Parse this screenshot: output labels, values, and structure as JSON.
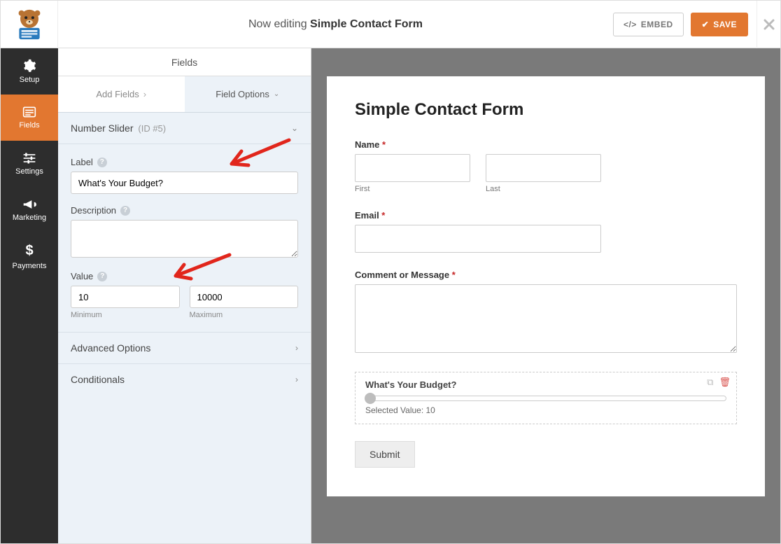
{
  "header": {
    "now_editing": "Now editing",
    "form_name": "Simple Contact Form",
    "embed": "EMBED",
    "save": "SAVE"
  },
  "sidebar": {
    "items": [
      {
        "icon": "gear",
        "label": "Setup"
      },
      {
        "icon": "list",
        "label": "Fields"
      },
      {
        "icon": "sliders",
        "label": "Settings"
      },
      {
        "icon": "bullhorn",
        "label": "Marketing"
      },
      {
        "icon": "dollar",
        "label": "Payments"
      }
    ]
  },
  "subheader": "Fields",
  "tabs": {
    "add_fields": "Add Fields",
    "field_options": "Field Options"
  },
  "options": {
    "title": "Number Slider",
    "title_id": "(ID #5)",
    "label_label": "Label",
    "label_value": "What's Your Budget?",
    "description_label": "Description",
    "description_value": "",
    "value_label": "Value",
    "min_value": "10",
    "min_label": "Minimum",
    "max_value": "10000",
    "max_label": "Maximum",
    "advanced": "Advanced Options",
    "conditionals": "Conditionals"
  },
  "preview": {
    "title": "Simple Contact Form",
    "name_label": "Name",
    "first": "First",
    "last": "Last",
    "email_label": "Email",
    "comment_label": "Comment or Message",
    "slider_label": "What's Your Budget?",
    "selected_value": "Selected Value: 10",
    "submit": "Submit"
  }
}
